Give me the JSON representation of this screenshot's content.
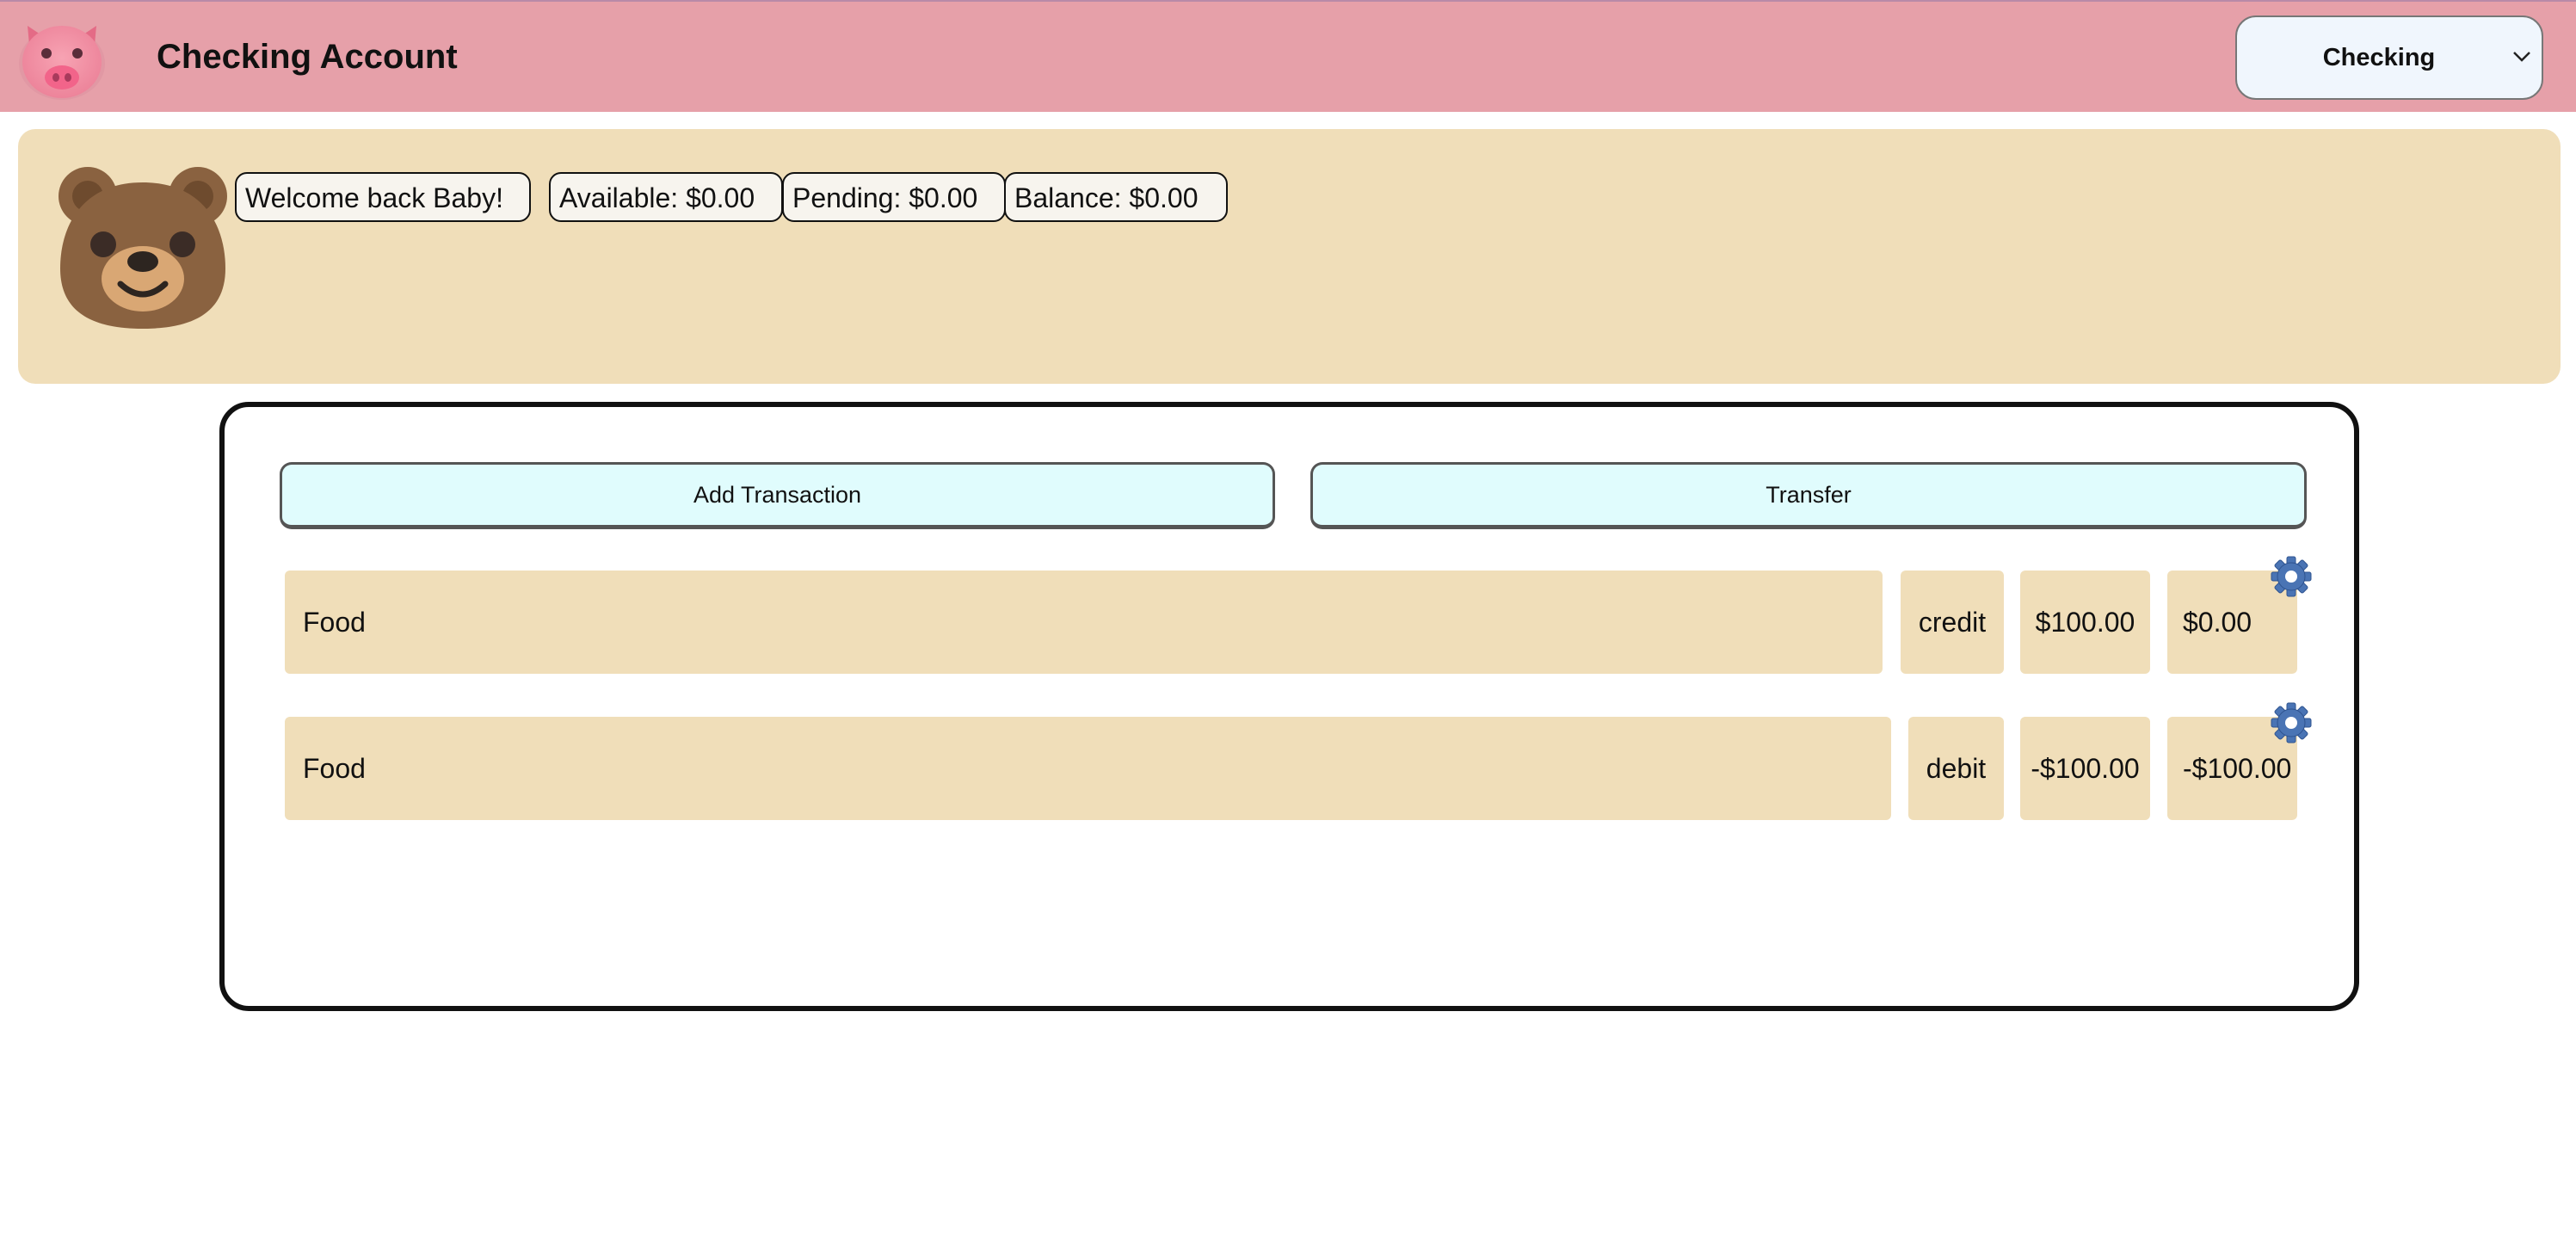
{
  "header": {
    "title": "Checking Account",
    "logo_icon": "pig-icon",
    "account_select": {
      "selected": "Checking",
      "icon": "chevron-down-icon"
    },
    "colors": {
      "bar": "#e6a0a9",
      "select_bg": "#f0f6fd"
    }
  },
  "welcome": {
    "avatar_icon": "bear-icon",
    "greeting": "Welcome back Baby!",
    "available": "Available: $0.00",
    "pending": "Pending: $0.00",
    "balance": "Balance: $0.00",
    "colors": {
      "panel": "#f0deb9"
    }
  },
  "actions": {
    "add_transaction": "Add Transaction",
    "transfer": "Transfer",
    "colors": {
      "button_bg": "#e0fcfd"
    }
  },
  "transactions": [
    {
      "description": "Food",
      "type": "credit",
      "amount": "$100.00",
      "running_balance": "$0.00",
      "settings_icon": "gear-icon"
    },
    {
      "description": "Food",
      "type": "debit",
      "amount": "-$100.00",
      "running_balance": "-$100.00",
      "settings_icon": "gear-icon"
    }
  ]
}
